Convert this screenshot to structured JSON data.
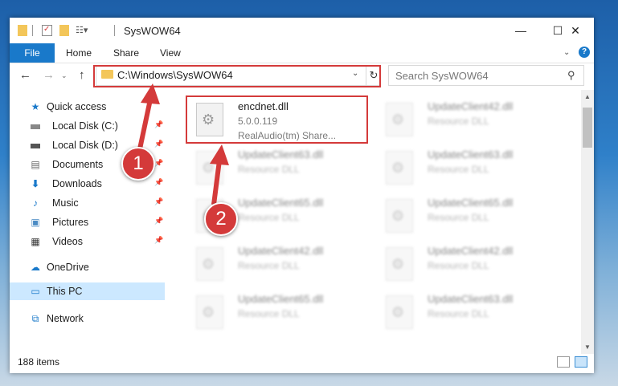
{
  "window": {
    "title": "SysWOW64",
    "controls": {
      "minimize": "—",
      "maximize": "☐",
      "close": "✕"
    }
  },
  "ribbon": {
    "tabs": [
      "File",
      "Home",
      "Share",
      "View"
    ],
    "help": "?"
  },
  "address_bar": {
    "path": "C:\\Windows\\SysWOW64"
  },
  "search": {
    "placeholder": "Search SysWOW64"
  },
  "nav_pane": {
    "items": [
      {
        "label": "Quick access",
        "icon": "star-icon"
      },
      {
        "label": "Local Disk (C:)",
        "icon": "drive-icon",
        "pinned": true
      },
      {
        "label": "Local Disk (D:)",
        "icon": "drive-icon",
        "pinned": true
      },
      {
        "label": "Documents",
        "icon": "documents-icon",
        "pinned": true
      },
      {
        "label": "Downloads",
        "icon": "download-icon",
        "pinned": true
      },
      {
        "label": "Music",
        "icon": "music-icon",
        "pinned": true
      },
      {
        "label": "Pictures",
        "icon": "pictures-icon",
        "pinned": true
      },
      {
        "label": "Videos",
        "icon": "videos-icon",
        "pinned": true
      },
      {
        "label": "OneDrive",
        "icon": "cloud-icon"
      },
      {
        "label": "This PC",
        "icon": "computer-icon",
        "selected": true
      },
      {
        "label": "Network",
        "icon": "network-icon"
      }
    ]
  },
  "files": {
    "selected": {
      "name": "encdnet.dll",
      "version": "5.0.0.119",
      "description": "RealAudio(tm) Share..."
    },
    "blurred": [
      {
        "name": "UpdateClient42.dll",
        "type": "Resource DLL"
      },
      {
        "name": "UpdateClient63.dll",
        "type": "Resource DLL"
      },
      {
        "name": "UpdateClient63.dll",
        "type": "Resource DLL"
      },
      {
        "name": "UpdateClient65.dll",
        "type": "Resource DLL"
      },
      {
        "name": "UpdateClient65.dll",
        "type": "Resource DLL"
      },
      {
        "name": "UpdateClient42.dll",
        "type": "Resource DLL"
      },
      {
        "name": "UpdateClient42.dll",
        "type": "Resource DLL"
      },
      {
        "name": "UpdateClient65.dll",
        "type": "Resource DLL"
      },
      {
        "name": "UpdateClient63.dll",
        "type": "Resource DLL"
      }
    ]
  },
  "status_bar": {
    "item_count": "188 items"
  },
  "annotations": {
    "step1": "1",
    "step2": "2",
    "accent": "#d43a3a"
  }
}
